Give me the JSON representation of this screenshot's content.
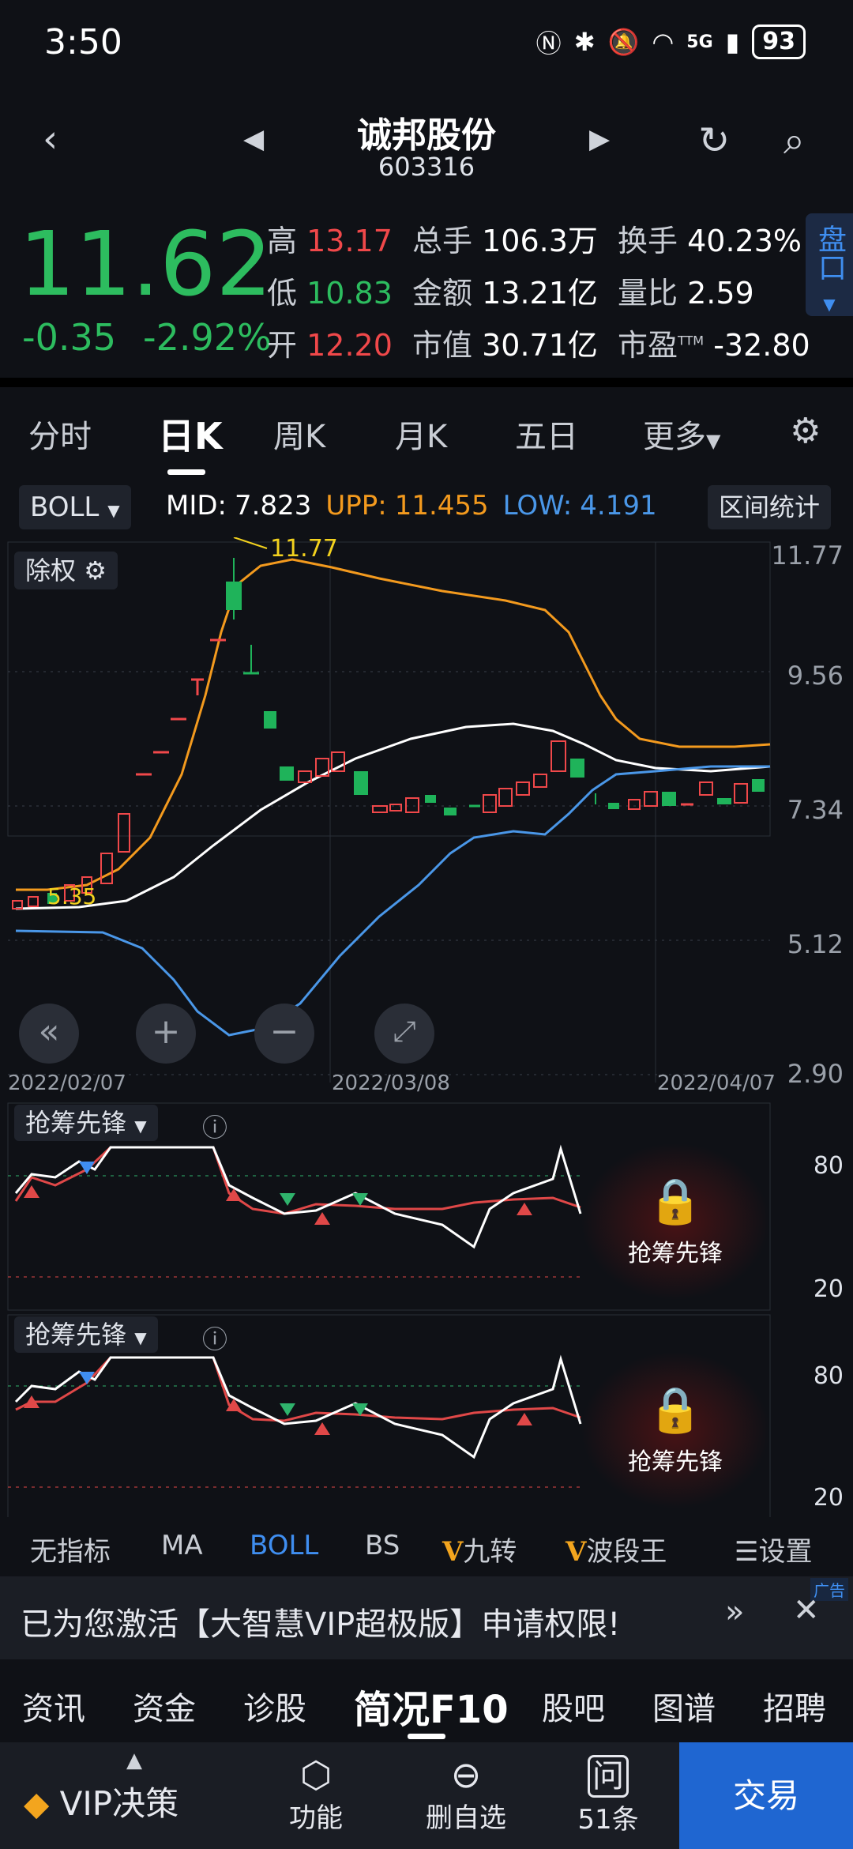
{
  "status": {
    "time": "3:50",
    "battery": "93",
    "network": "5G"
  },
  "header": {
    "name": "诚邦股份",
    "code": "603316"
  },
  "quote": {
    "price": "11.62",
    "change": "-0.35",
    "change_pct": "-2.92%",
    "high_label": "高",
    "high": "13.17",
    "low_label": "低",
    "low": "10.83",
    "open_label": "开",
    "open": "12.20",
    "vol_label": "总手",
    "vol": "106.3万",
    "amount_label": "金额",
    "amount": "13.21亿",
    "mcap_label": "市值",
    "mcap": "30.71亿",
    "turnover_label": "换手",
    "turnover": "40.23%",
    "ratio_label": "量比",
    "ratio": "2.59",
    "pe_label": "市盈",
    "pe_sup": "TTM",
    "pe": "-32.80",
    "pankou": "盘口"
  },
  "tabs": [
    "分时",
    "日K",
    "周K",
    "月K",
    "五日",
    "更多"
  ],
  "indicator": {
    "select": "BOLL",
    "mid_label": "MID:",
    "mid": "7.823",
    "upp_label": "UPP:",
    "upp": "11.455",
    "low_label": "LOW:",
    "low": "4.191",
    "interval": "区间统计",
    "chuquan": "除权"
  },
  "main_chart": {
    "y_ticks": [
      "11.77",
      "9.56",
      "7.34",
      "5.12",
      "2.90"
    ],
    "x_ticks": [
      "2022/02/07",
      "2022/03/08",
      "2022/04/07"
    ],
    "max_label": "11.77",
    "min_label": "5.35",
    "colors": {
      "mid": "#ffffff",
      "upp": "#f39a1e",
      "low": "#4a97e8",
      "up": "#f0484a",
      "down": "#1fb35a"
    }
  },
  "sub1": {
    "select": "抢筹先锋",
    "y_ticks": [
      "80",
      "20"
    ],
    "lock_text": "抢筹先锋"
  },
  "sub2": {
    "select": "抢筹先锋",
    "y_ticks": [
      "80",
      "20"
    ],
    "lock_text": "抢筹先锋"
  },
  "bottom_indicators": [
    "无指标",
    "MA",
    "BOLL",
    "BS",
    "九转",
    "波段王",
    "设置"
  ],
  "banner": {
    "text": "已为您激活【大智慧VIP超极版】申请权限!",
    "ad": "广告"
  },
  "f10_nav": [
    "资讯",
    "资金",
    "诊股",
    "简况F10",
    "股吧",
    "图谱",
    "招聘"
  ],
  "dock": {
    "vip": "VIP决策",
    "func": "功能",
    "del": "删自选",
    "ask": "51条",
    "trade": "交易"
  }
}
